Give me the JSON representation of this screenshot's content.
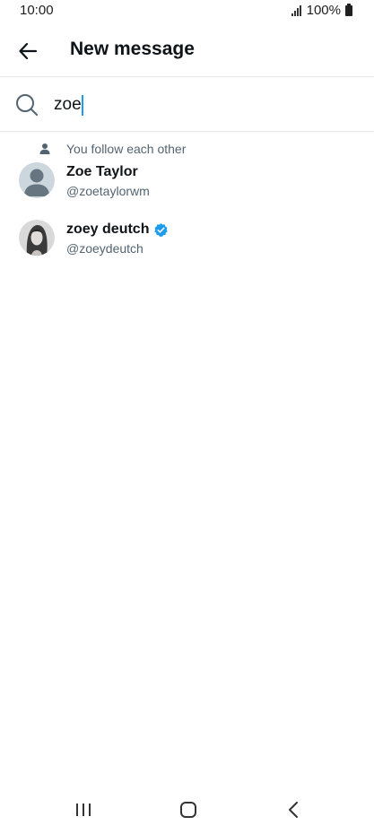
{
  "status_bar": {
    "time": "10:00",
    "battery_text": "100%"
  },
  "header": {
    "title": "New message",
    "back_icon": "arrow-left-icon"
  },
  "search": {
    "value": "zoe",
    "icon": "search-icon"
  },
  "results": {
    "social_context": "You follow each other",
    "users": [
      {
        "name": "Zoe Taylor",
        "handle": "@zoetaylorwm",
        "verified": false,
        "avatar": "default-avatar"
      },
      {
        "name": "zoey deutch",
        "handle": "@zoeydeutch",
        "verified": true,
        "avatar": "photo-avatar"
      }
    ]
  },
  "colors": {
    "accent": "#1d9bf0",
    "text_primary": "#0f1419",
    "text_secondary": "#536471",
    "divider": "#e6e9eb"
  },
  "nav_bar": {
    "recent_icon": "recent-apps-icon",
    "home_icon": "home-icon",
    "back_icon": "back-chevron-icon"
  }
}
